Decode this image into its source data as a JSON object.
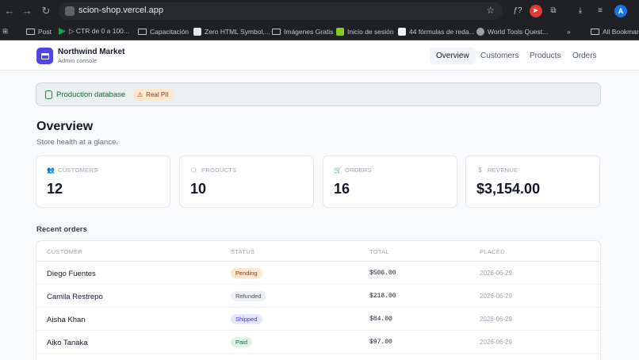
{
  "browser": {
    "url": "scion-shop.vercel.app",
    "bookmarks": [
      {
        "label": "Post",
        "icon": "folder-icon"
      },
      {
        "label": "▷ CTR de 0 a 100...",
        "icon": "green-arrow-icon"
      },
      {
        "label": "Capacitación",
        "icon": "folder-icon"
      },
      {
        "label": "Zero HTML Symbol,...",
        "icon": "site-icon"
      },
      {
        "label": "Imágenes Gratis",
        "icon": "folder-icon"
      },
      {
        "label": "Inicio de sesión",
        "icon": "leaf-icon"
      },
      {
        "label": "44 fórmulas de reda...",
        "icon": "site-icon"
      },
      {
        "label": "World Tools Quest...",
        "icon": "globe-icon"
      },
      {
        "label": "All Bookmarks",
        "icon": "folder-icon"
      }
    ],
    "overflow": "»",
    "profile_initial": "A"
  },
  "header": {
    "brand_title": "Northwind Market",
    "brand_subtitle": "Admin console",
    "nav": [
      {
        "label": "Overview",
        "active": true
      },
      {
        "label": "Customers",
        "active": false
      },
      {
        "label": "Products",
        "active": false
      },
      {
        "label": "Orders",
        "active": false
      }
    ]
  },
  "banner": {
    "db_label": "Production database",
    "pii_label": "Real PII"
  },
  "overview": {
    "title": "Overview",
    "subtitle": "Store health at a glance."
  },
  "stats": [
    {
      "label": "CUSTOMERS",
      "value": "12",
      "icon": "users-icon"
    },
    {
      "label": "PRODUCTS",
      "value": "10",
      "icon": "box-icon"
    },
    {
      "label": "ORDERS",
      "value": "16",
      "icon": "cart-icon"
    },
    {
      "label": "REVENUE",
      "value": "$3,154.00",
      "icon": "dollar-icon"
    }
  ],
  "recent_orders": {
    "title": "Recent orders",
    "columns": [
      "CUSTOMER",
      "STATUS",
      "TOTAL",
      "PLACED"
    ],
    "rows": [
      {
        "customer": "Diego Fuentes",
        "status": "Pending",
        "total": "$506.00",
        "placed": "2026-06-29"
      },
      {
        "customer": "Camila Restrepo",
        "status": "Refunded",
        "total": "$218.00",
        "placed": "2026-06-29"
      },
      {
        "customer": "Aisha Khan",
        "status": "Shipped",
        "total": "$84.00",
        "placed": "2026-06-29"
      },
      {
        "customer": "Aiko Tanaka",
        "status": "Paid",
        "total": "$97.00",
        "placed": "2026-06-29"
      }
    ]
  },
  "status_colors": {
    "Pending": {
      "bg": "#fde7cd",
      "fg": "#9a3412"
    },
    "Refunded": {
      "bg": "#eef0f3",
      "fg": "#4b5563"
    },
    "Shipped": {
      "bg": "#e5e7fb",
      "fg": "#4338ca"
    },
    "Paid": {
      "bg": "#dcf3e2",
      "fg": "#166534"
    }
  }
}
